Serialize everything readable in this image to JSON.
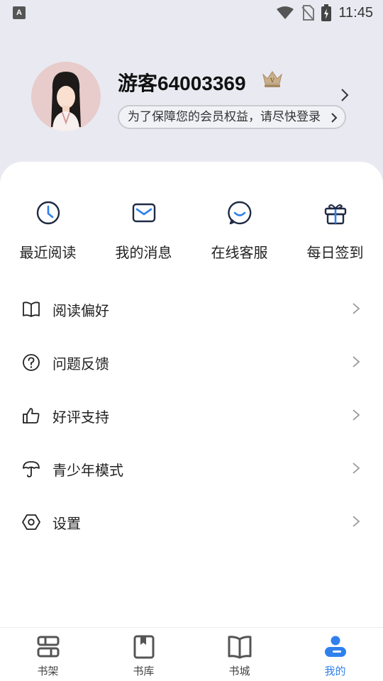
{
  "status_bar": {
    "app_icon_letter": "A",
    "time": "11:45"
  },
  "profile": {
    "username": "游客64003369",
    "login_tip": "为了保障您的会员权益，请尽快登录"
  },
  "quick_actions": [
    {
      "label": "最近阅读",
      "icon": "clock-icon"
    },
    {
      "label": "我的消息",
      "icon": "envelope-icon"
    },
    {
      "label": "在线客服",
      "icon": "chat-bubble-icon"
    },
    {
      "label": "每日签到",
      "icon": "gift-icon"
    }
  ],
  "menu": [
    {
      "label": "阅读偏好",
      "icon": "open-book-icon"
    },
    {
      "label": "问题反馈",
      "icon": "question-circle-icon"
    },
    {
      "label": "好评支持",
      "icon": "thumbs-up-icon"
    },
    {
      "label": "青少年模式",
      "icon": "umbrella-icon"
    },
    {
      "label": "设置",
      "icon": "settings-hexagon-icon"
    }
  ],
  "tabbar": [
    {
      "label": "书架",
      "icon": "bookshelf-icon"
    },
    {
      "label": "书库",
      "icon": "bookmark-book-icon"
    },
    {
      "label": "书城",
      "icon": "book-icon"
    },
    {
      "label": "我的",
      "icon": "user-icon",
      "active": true
    }
  ],
  "colors": {
    "accent": "#2f80ed",
    "header_bg": "#e9eaf1",
    "icon_dark": "#1f2a44"
  }
}
